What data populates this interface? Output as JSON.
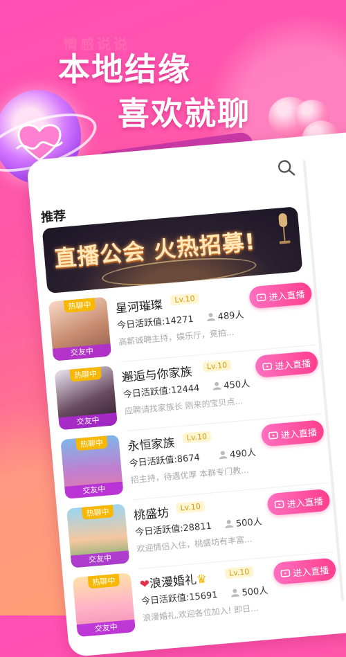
{
  "hero": {
    "ghost_text": "情感说说",
    "line1": "本地结缘",
    "line2": "喜欢就聊"
  },
  "screen": {
    "tab_title": "推荐",
    "banner_text": "直播公会 火热招募!",
    "rooms": [
      {
        "name": "星河璀璨",
        "level": "Lv.10",
        "activity": "今日活跃值:14271",
        "members": "489人",
        "desc": "高薪诚聘主持，娱乐厅，竞拍...",
        "hot": "热聊中",
        "status": "交友中",
        "enter": "进入直播"
      },
      {
        "name": "邂逅与你家族",
        "level": "Lv.10",
        "activity": "今日活跃值:12444",
        "members": "450人",
        "desc": "应聘请找家族长 刚来的宝贝点...",
        "hot": "热聊中",
        "status": "交友中",
        "enter": "进入直播"
      },
      {
        "name": "永恒家族",
        "level": "Lv.10",
        "activity": "今日活跃值:8674",
        "members": "490人",
        "desc": "招主持，待遇优厚 本群专门教...",
        "hot": "热聊中",
        "status": "交友中",
        "enter": "进入直播"
      },
      {
        "name": "桃盛坊",
        "level": "Lv.10",
        "activity": "今日活跃值:28811",
        "members": "500人",
        "desc": "欢迎情侣入住，桃盛坊有丰富...",
        "hot": "热聊中",
        "status": "交友中",
        "enter": "进入直播"
      },
      {
        "name": "浪漫婚礼",
        "level": "Lv.10",
        "activity": "今日活跃值:15691",
        "members": "500人",
        "desc": "浪漫婚礼,欢迎各位加入! 即日...",
        "hot": "热聊中",
        "status": "交友中",
        "enter": "进入直播"
      }
    ]
  },
  "colors": {
    "accent": "#ff3f8e",
    "hot_badge": "#f8b700",
    "status_bar": "#b428dc"
  }
}
